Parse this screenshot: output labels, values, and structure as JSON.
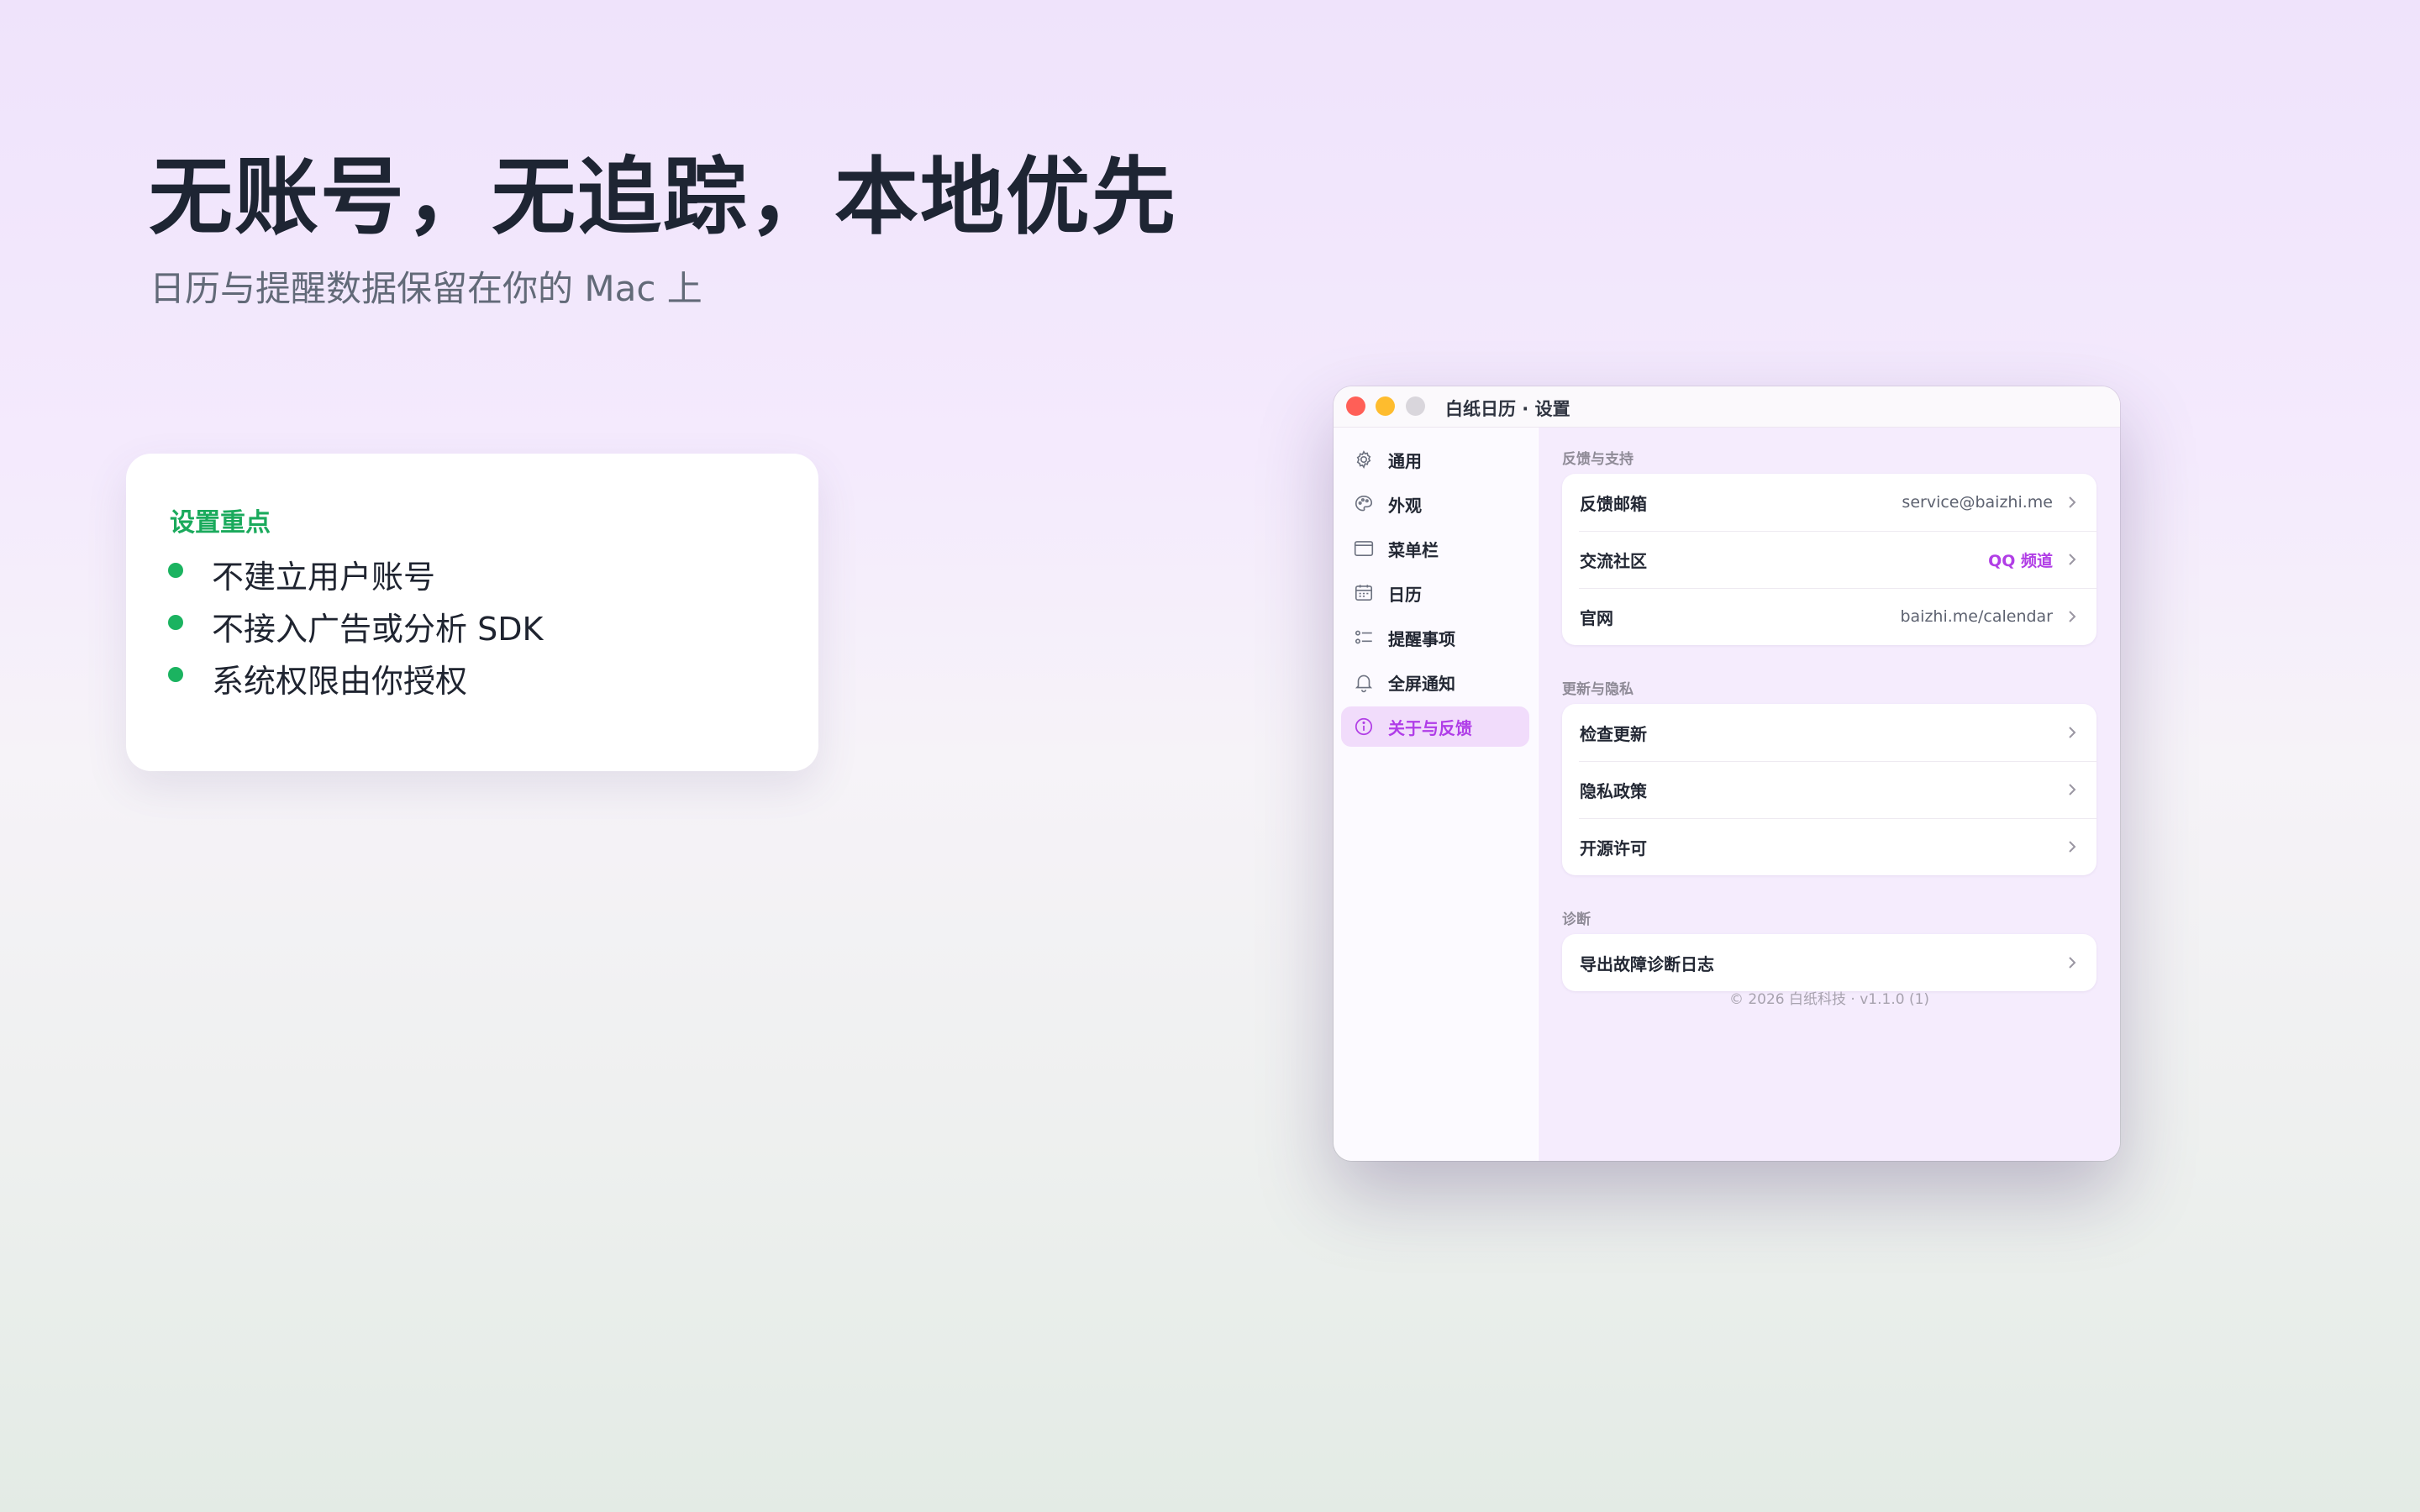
{
  "hero": {
    "title": "无账号，无追踪，本地优先",
    "subtitle": "日历与提醒数据保留在你的 Mac 上"
  },
  "card": {
    "title": "设置重点",
    "bullets": [
      "不建立用户账号",
      "不接入广告或分析 SDK",
      "系统权限由你授权"
    ],
    "accent_color": "#1bb360"
  },
  "window": {
    "title": "白纸日历 · 设置",
    "sidebar": {
      "items": [
        {
          "label": "通用",
          "icon": "gear-icon"
        },
        {
          "label": "外观",
          "icon": "palette-icon"
        },
        {
          "label": "菜单栏",
          "icon": "menubar-icon"
        },
        {
          "label": "日历",
          "icon": "calendar-icon"
        },
        {
          "label": "提醒事项",
          "icon": "checklist-icon"
        },
        {
          "label": "全屏通知",
          "icon": "bell-icon"
        },
        {
          "label": "关于与反馈",
          "icon": "info-icon",
          "active": true
        }
      ]
    },
    "sections": [
      {
        "title": "反馈与支持",
        "rows": [
          {
            "label": "反馈邮箱",
            "value": "service@baizhi.me"
          },
          {
            "label": "交流社区",
            "value": "QQ 频道"
          },
          {
            "label": "官网",
            "value": "baizhi.me/calendar"
          }
        ]
      },
      {
        "title": "更新与隐私",
        "rows": [
          {
            "label": "检查更新",
            "value": ""
          },
          {
            "label": "隐私政策",
            "value": ""
          },
          {
            "label": "开源许可",
            "value": ""
          }
        ]
      },
      {
        "title": "诊断",
        "rows": [
          {
            "label": "导出故障诊断日志",
            "value": ""
          }
        ]
      }
    ],
    "footer": "© 2026 白纸科技 · v1.1.0 (1)",
    "accent_color": "#b13ee6"
  }
}
